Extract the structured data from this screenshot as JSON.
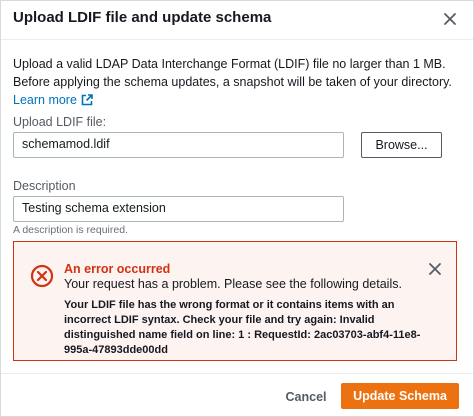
{
  "dialog": {
    "title": "Upload LDIF file and update schema",
    "intro": "Upload a valid LDAP Data Interchange Format (LDIF) file no larger than 1 MB. Before applying the schema updates, a snapshot will be taken of your directory.",
    "learn_more": "Learn more"
  },
  "upload": {
    "label": "Upload LDIF file:",
    "file_name": "schemamod.ldif",
    "browse_label": "Browse..."
  },
  "description": {
    "label": "Description",
    "value": "Testing schema extension",
    "hint": "A description is required."
  },
  "alert": {
    "title": "An error occurred",
    "subtitle": "Your request has a problem. Please see the following details.",
    "details": "Your LDIF file has the wrong format or it contains items with an incorrect LDIF syntax. Check your file and try again: Invalid distinguished name field on line: 1 : RequestId: 2ac03703-abf4-11e8-995a-47893dde00dd"
  },
  "footer": {
    "cancel_label": "Cancel",
    "submit_label": "Update Schema"
  },
  "icons": {
    "close": "close-icon",
    "external_link": "external-link-icon",
    "error": "error-circle-icon"
  },
  "colors": {
    "accent_orange": "#ec7211",
    "error_red": "#d13212",
    "link_blue": "#0073bb",
    "alert_bg": "#fdf3f1"
  }
}
